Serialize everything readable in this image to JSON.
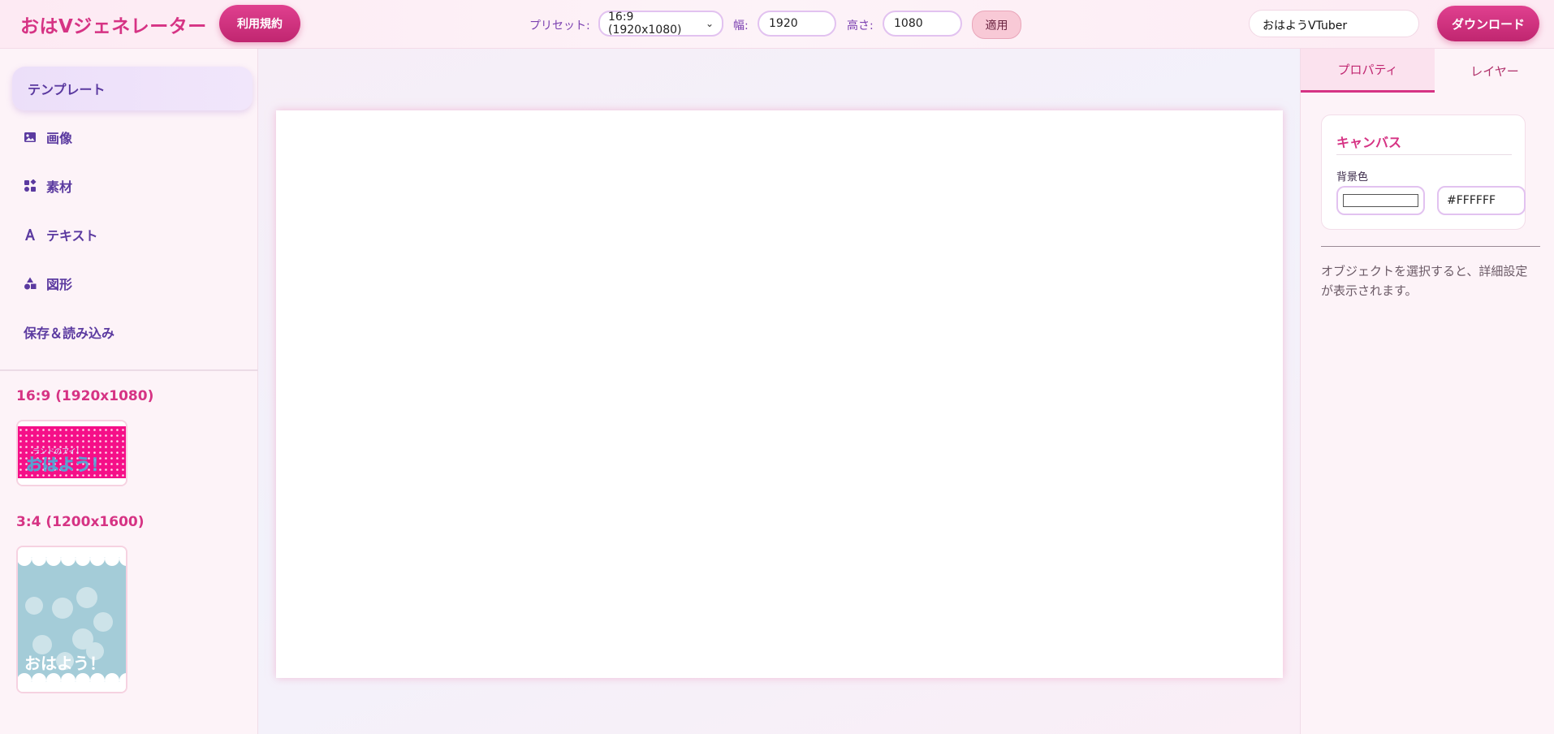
{
  "header": {
    "logo": "おはVジェネレーター",
    "terms_button": "利用規約",
    "preset_label": "プリセット:",
    "preset_value": "16:9 (1920x1080)",
    "width_label": "幅:",
    "width_value": "1920",
    "height_label": "高さ:",
    "height_value": "1080",
    "apply_button": "適用",
    "project_name": "おはようVTuber",
    "download_button": "ダウンロード"
  },
  "sidebar": {
    "items": [
      {
        "label": "テンプレート",
        "icon": "none"
      },
      {
        "label": "画像",
        "icon": "image-icon"
      },
      {
        "label": "素材",
        "icon": "shapes-icon"
      },
      {
        "label": "テキスト",
        "icon": "text-icon"
      },
      {
        "label": "図形",
        "icon": "shape-icon"
      },
      {
        "label": "保存＆読み込み",
        "icon": "none"
      }
    ],
    "templates": [
      {
        "title": "16:9 (1920x1080)",
        "thumb_caption_small": "ランドのアイ！",
        "thumb_caption": "おはよう！"
      },
      {
        "title": "3:4 (1200x1600)",
        "thumb_caption": "おはよう！"
      }
    ]
  },
  "right_panel": {
    "tabs": [
      "プロパティ",
      "レイヤー"
    ],
    "card_title": "キャンバス",
    "bg_color_label": "背景色",
    "bg_color_value": "#FFFFFF",
    "hint": "オブジェクトを選択すると、詳細設定が表示されます。"
  },
  "colors": {
    "accent": "#d63384",
    "canvas_bg": "#FFFFFF",
    "template1_bg": "#f50f88",
    "template2_bg": "#a4ccd8"
  }
}
